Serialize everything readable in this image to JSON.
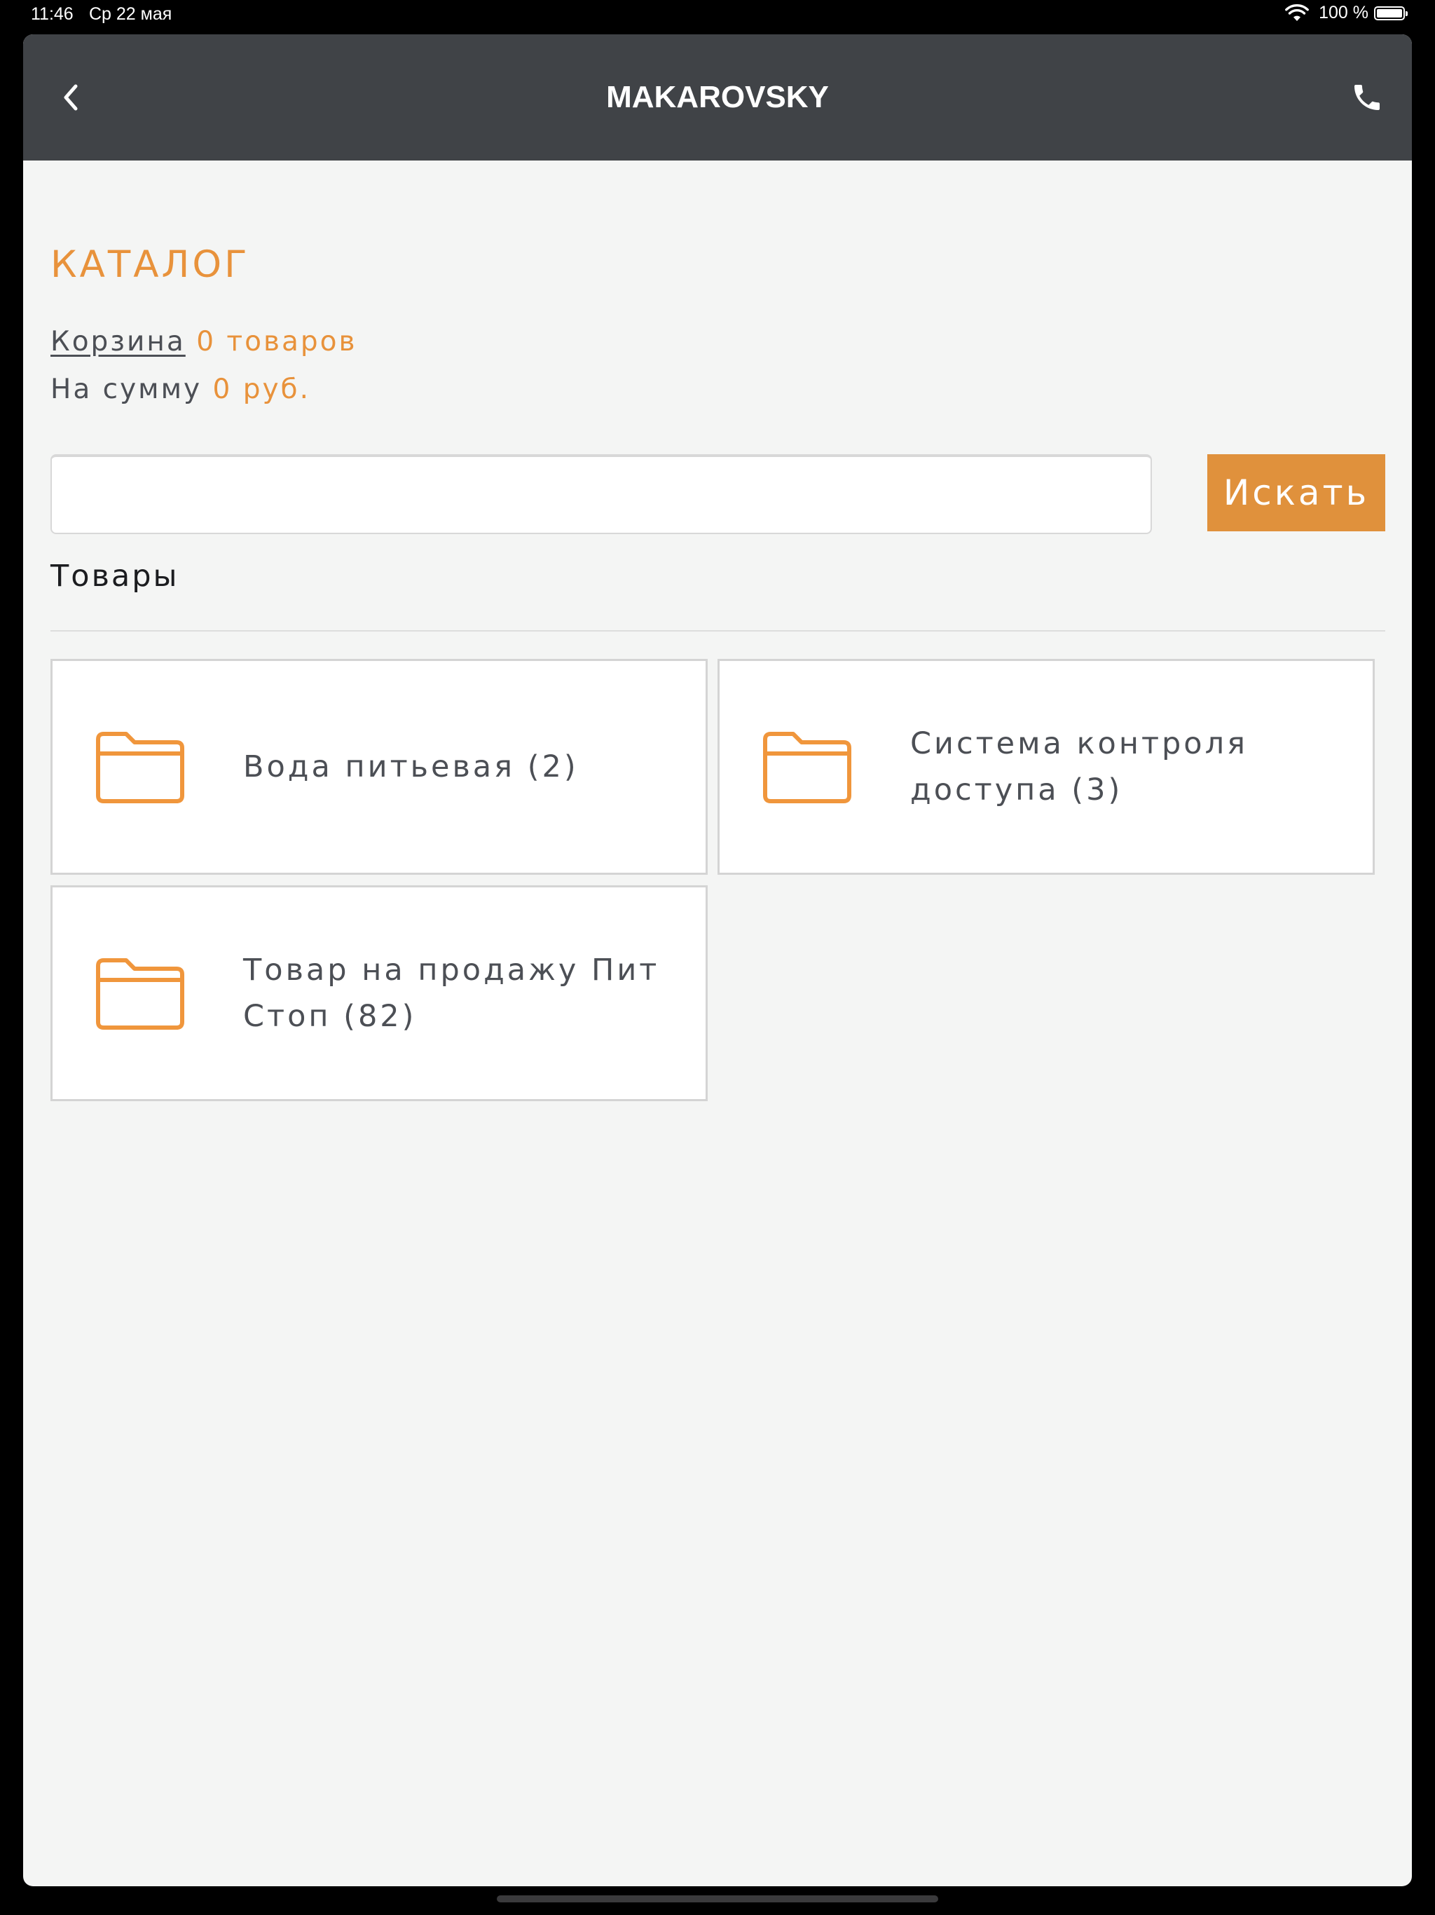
{
  "status_bar": {
    "time": "11:46",
    "date": "Ср 22 мая",
    "battery": "100 %",
    "wifi_icon": "wifi-icon",
    "battery_icon": "battery-icon"
  },
  "nav": {
    "title": "MAKAROVSKY",
    "back_icon": "chevron-left-icon",
    "phone_icon": "phone-icon"
  },
  "catalog": {
    "title": "КАТАЛОГ",
    "cart_label": "Корзина",
    "cart_count": "0 товаров",
    "sum_label": "На сумму",
    "sum_value": "0 руб."
  },
  "search": {
    "value": "",
    "placeholder": "",
    "button_label": "Искать"
  },
  "section": {
    "heading": "Товары"
  },
  "categories": [
    {
      "label": "Вода питьевая (2)",
      "icon": "folder-icon"
    },
    {
      "label": "Система контроля доступа (3)",
      "icon": "folder-icon"
    },
    {
      "label": "Товар на продажу Пит Стоп (82)",
      "icon": "folder-icon"
    }
  ],
  "colors": {
    "accent": "#e8923b",
    "nav_background": "#404347",
    "page_background": "#f4f5f4",
    "text": "#4c4f55"
  }
}
